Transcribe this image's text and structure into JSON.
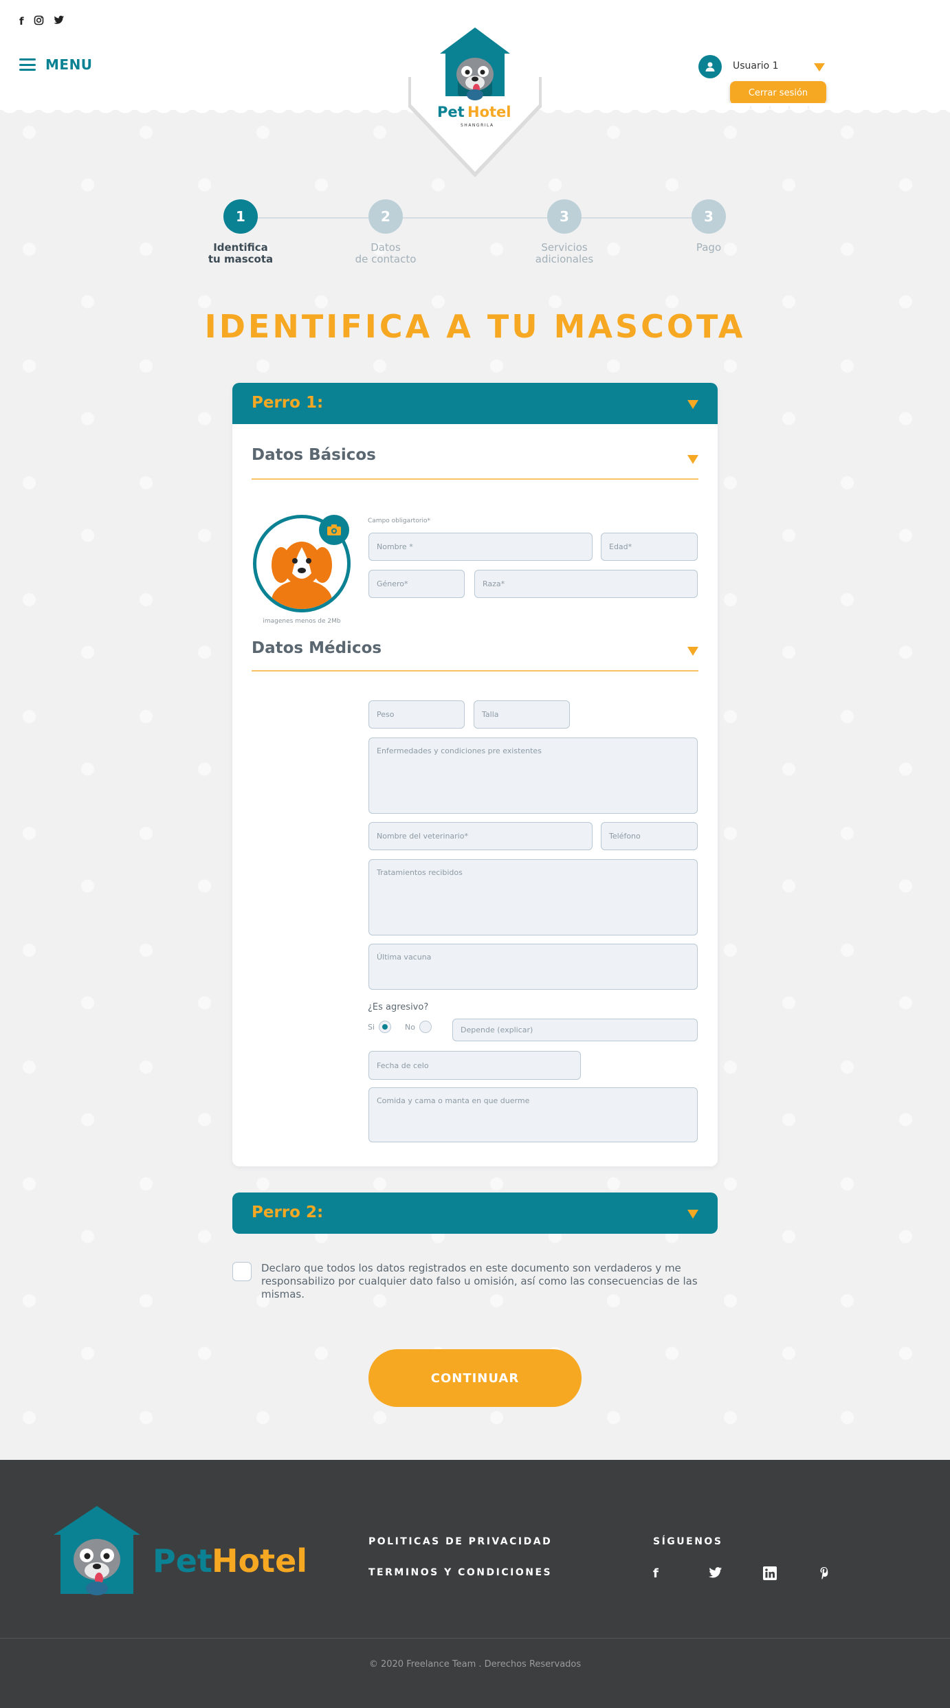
{
  "header": {
    "social": [
      "f",
      "◎",
      "🐦"
    ],
    "menu_label": "MENU",
    "logo_text_pet": "Pet",
    "logo_text_hotel": "Hotel",
    "logo_subtext": "SHANGRILA",
    "user_name": "Usuario 1",
    "logout_label": "Cerrar sesión"
  },
  "steps": [
    {
      "number": "1",
      "line1": "Identifica",
      "line2": "tu mascota"
    },
    {
      "number": "2",
      "line1": "Datos",
      "line2": "de contacto"
    },
    {
      "number": "3",
      "line1": "Servicios",
      "line2": "adicionales"
    },
    {
      "number": "3",
      "line1": "Pago",
      "line2": ""
    }
  ],
  "page_title": "IDENTIFICA A TU MASCOTA",
  "dog1": {
    "title": "Perro 1:",
    "basic_title": "Datos Básicos",
    "required_note": "Campo obligartorio*",
    "image_note": "imagenes menos de 2Mb",
    "fields": {
      "nombre": "Nombre *",
      "edad": "Edad*",
      "genero": "Género*",
      "raza": "Raza*"
    },
    "medical_title": "Datos Médicos",
    "medical": {
      "peso": "Peso",
      "talla": "Talla",
      "enfermedades": "Enfermedades y condiciones pre existentes",
      "veterinario": "Nombre del veterinario*",
      "telefono": "Teléfono",
      "tratamientos": "Tratamientos recibidos",
      "vacuna": "Última vacuna",
      "agresivo_q": "¿Es agresivo?",
      "si": "Si",
      "no": "No",
      "depende": "Depende (explicar)",
      "celo": "Fecha de celo",
      "comida": "Comida y cama o manta en que duerme"
    }
  },
  "dog2": {
    "title": "Perro 2:"
  },
  "declaration": "Declaro que todos los datos registrados en este documento son verdaderos y me responsabilizo por cualquier dato falso u omisión, así como las consecuencias de las mismas.",
  "continue_label": "CONTINUAR",
  "footer": {
    "logo_pet": "Pet",
    "logo_hotel": "Hotel",
    "privacy": "POLITICAS DE PRIVACIDAD",
    "terms": "TERMINOS Y CONDICIONES",
    "follow": "SÍGUENOS",
    "social": [
      "f",
      "🐦",
      "in",
      "℗"
    ],
    "copyright": "© 2020 Freelance Team . Derechos Reservados"
  },
  "colors": {
    "teal": "#0b8293",
    "orange": "#f7a823",
    "footer_bg": "#3d3e40"
  }
}
